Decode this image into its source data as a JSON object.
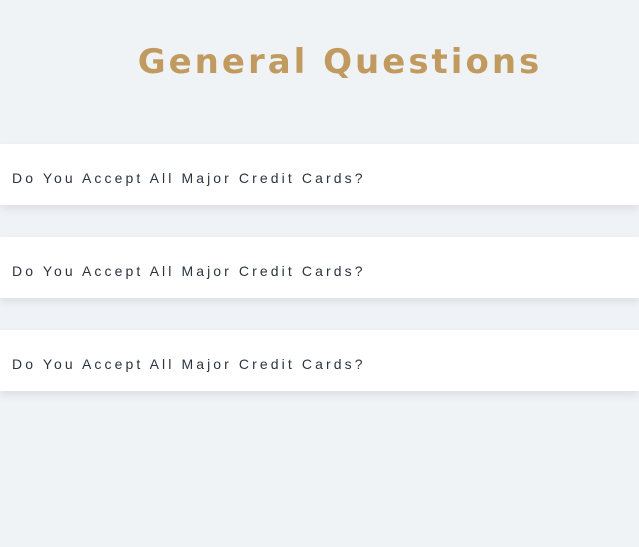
{
  "page": {
    "title": "General Questions"
  },
  "faq": {
    "items": [
      {
        "question": "Do You Accept All Major Credit Cards?"
      },
      {
        "question": "Do You Accept All Major Credit Cards?"
      },
      {
        "question": "Do You Accept All Major Credit Cards?"
      }
    ]
  },
  "colors": {
    "background": "#f0f3f6",
    "title": "#c19a5f",
    "card": "#ffffff",
    "question_text": "#2c3440"
  }
}
